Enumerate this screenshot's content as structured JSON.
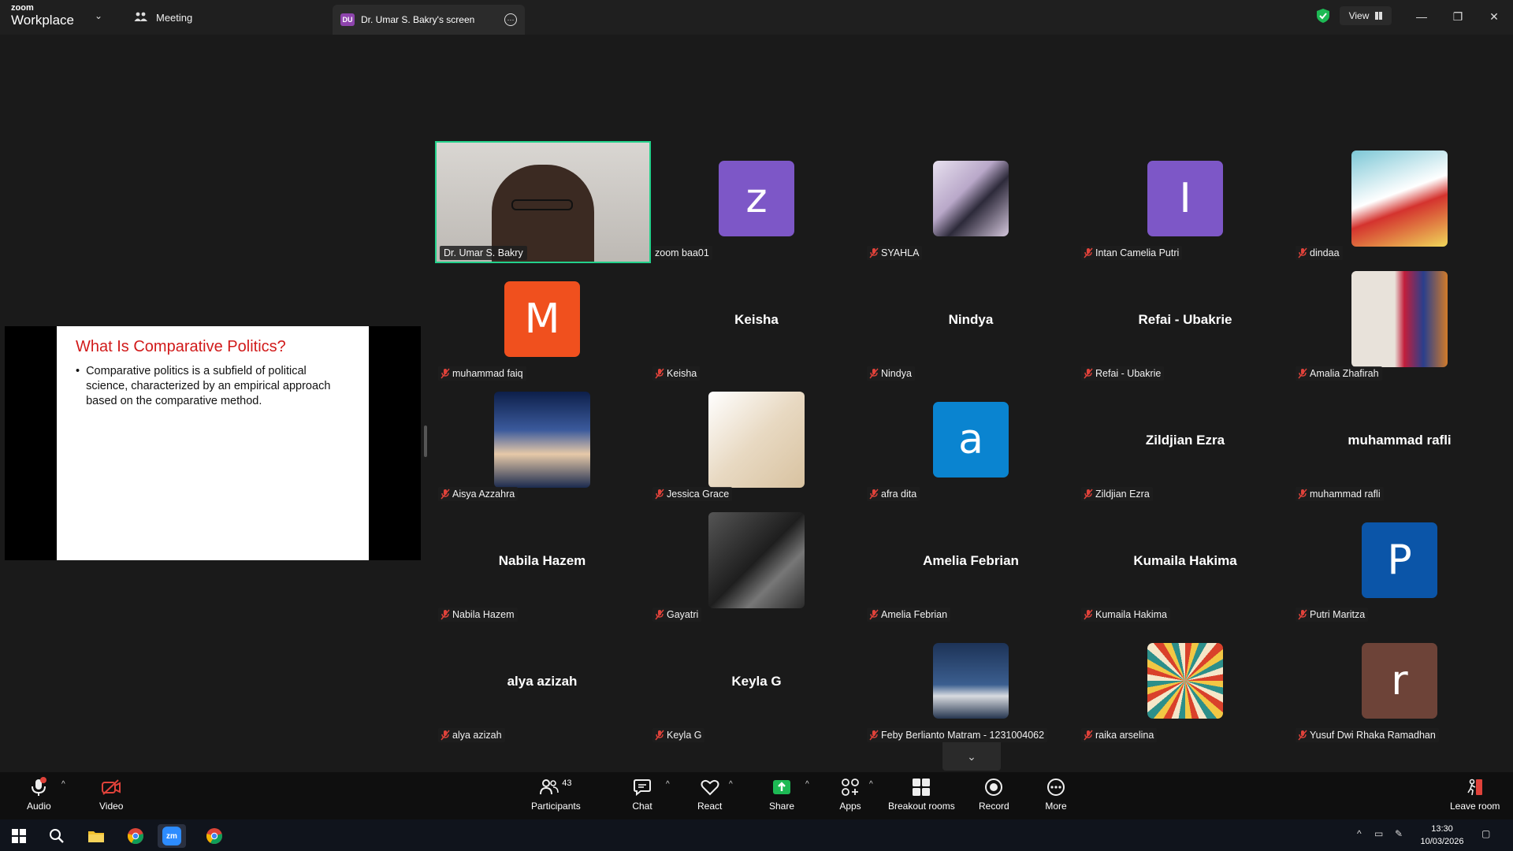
{
  "titlebar": {
    "logo_line1": "zoom",
    "logo_line2": "Workplace",
    "meeting_tab": "Meeting",
    "screen_tab_initials": "DU",
    "screen_tab_label": "Dr. Umar S. Bakry's screen",
    "view_label": "View"
  },
  "shared_slide": {
    "title": "What Is Comparative Politics?",
    "bullet": "Comparative politics is a subfield of political science, characterized by an empirical approach based on the comparative method."
  },
  "participants": [
    {
      "tile_name": "Dr. Umar S. Bakry",
      "kind": "video"
    },
    {
      "tile_name": "zoom baa01",
      "kind": "avatar",
      "letter": "z",
      "color": "#7d57c7",
      "muted": false
    },
    {
      "tile_name": "SYAHLA",
      "kind": "photo",
      "muted": true
    },
    {
      "tile_name": "Intan Camelia Putri",
      "kind": "avatar",
      "letter": "I",
      "color": "#7d57c7",
      "muted": true
    },
    {
      "tile_name": "dindaa",
      "kind": "photo",
      "muted": true
    },
    {
      "tile_name": "muhammad faiq",
      "kind": "avatar",
      "letter": "M",
      "color": "#f0501e",
      "muted": true
    },
    {
      "tile_name": "Keisha",
      "center": "Keisha",
      "kind": "name",
      "muted": true
    },
    {
      "tile_name": "Nindya",
      "center": "Nindya",
      "kind": "name",
      "muted": true
    },
    {
      "tile_name": "Refai - Ubakrie",
      "center": "Refai - Ubakrie",
      "kind": "name",
      "muted": true
    },
    {
      "tile_name": "Amalia Zhafirah",
      "kind": "photo",
      "muted": true
    },
    {
      "tile_name": "Aisya Azzahra",
      "kind": "photo",
      "muted": true
    },
    {
      "tile_name": "Jessica Grace",
      "kind": "photo",
      "muted": true
    },
    {
      "tile_name": "afra dita",
      "kind": "avatar",
      "letter": "a",
      "color": "#0a84d0",
      "muted": true
    },
    {
      "tile_name": "Zildjian Ezra",
      "center": "Zildjian Ezra",
      "kind": "name",
      "muted": true
    },
    {
      "tile_name": "muhammad rafli",
      "center": "muhammad rafli",
      "kind": "name",
      "muted": true
    },
    {
      "tile_name": "Nabila Hazem",
      "center": "Nabila Hazem",
      "kind": "name",
      "muted": true
    },
    {
      "tile_name": "Gayatri",
      "kind": "photo",
      "muted": true
    },
    {
      "tile_name": "Amelia Febrian",
      "center": "Amelia Febrian",
      "kind": "name",
      "muted": true
    },
    {
      "tile_name": "Kumaila Hakima",
      "center": "Kumaila Hakima",
      "kind": "name",
      "muted": true
    },
    {
      "tile_name": "Putri Maritza",
      "kind": "avatar",
      "letter": "P",
      "color": "#0b55a8",
      "muted": true
    },
    {
      "tile_name": "alya azizah",
      "center": "alya azizah",
      "kind": "name",
      "muted": true
    },
    {
      "tile_name": "Keyla G",
      "center": "Keyla G",
      "kind": "name",
      "muted": true
    },
    {
      "tile_name": "Feby Berlianto Matram - 1231004062",
      "kind": "photo",
      "muted": true
    },
    {
      "tile_name": "raika arselina",
      "kind": "photo",
      "muted": true
    },
    {
      "tile_name": "Yusuf Dwi Rhaka Ramadhan",
      "kind": "avatar",
      "letter": "r",
      "color": "#6d4338",
      "muted": true
    }
  ],
  "toolbar": {
    "audio": "Audio",
    "video": "Video",
    "participants": "Participants",
    "participants_count": "43",
    "chat": "Chat",
    "react": "React",
    "share": "Share",
    "apps": "Apps",
    "breakout": "Breakout rooms",
    "record": "Record",
    "more": "More",
    "leave": "Leave room"
  },
  "taskbar": {
    "time": "13:30",
    "date": "10/03/2026",
    "zoom_icon_label": "zm"
  },
  "colors": {
    "active_speaker_border": "#23d18b",
    "share_green": "#1db954",
    "mute_red": "#e0423a"
  }
}
